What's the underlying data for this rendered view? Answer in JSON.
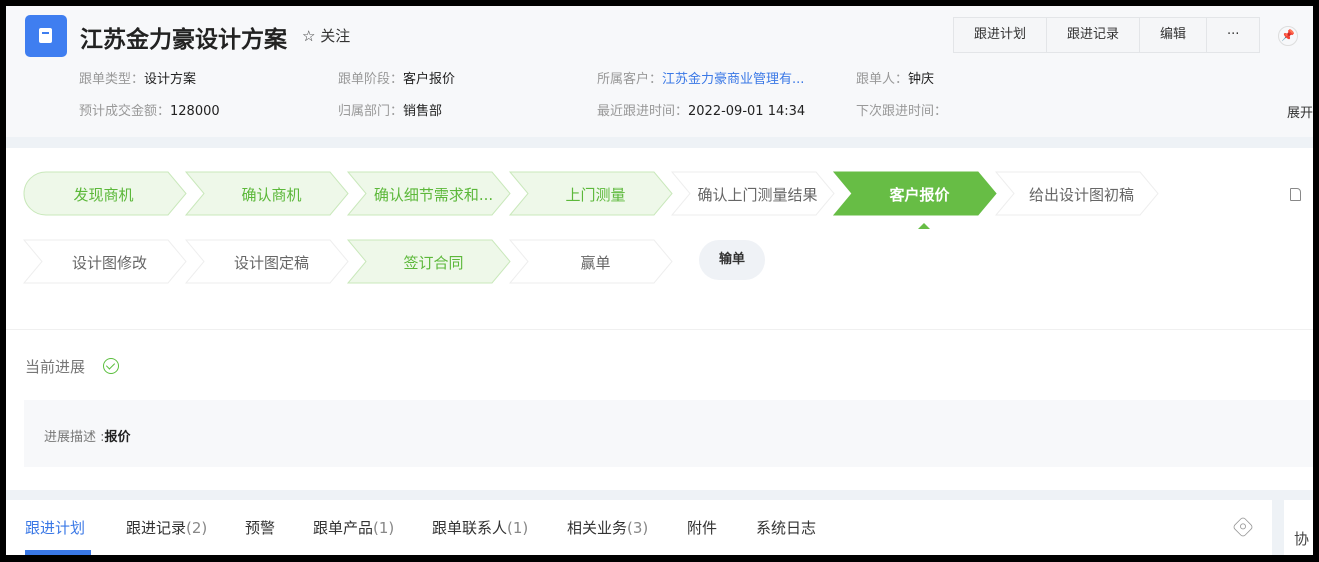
{
  "header": {
    "title": "江苏金力豪设计方案",
    "follow_label": "关注",
    "buttons": [
      "跟进计划",
      "跟进记录",
      "编辑",
      "···"
    ],
    "meta": [
      {
        "label": "跟单类型：",
        "value": "设计方案"
      },
      {
        "label": "跟单阶段：",
        "value": "客户报价"
      },
      {
        "label": "所属客户：",
        "value": "江苏金力豪商业管理有..."
      },
      {
        "label": "跟单人：",
        "value": "钟庆"
      },
      {
        "label": "预计成交金额：",
        "value": "128000"
      },
      {
        "label": "归属部门：",
        "value": "销售部"
      },
      {
        "label": "最近跟进时间：",
        "value": "2022-09-01 14:34"
      },
      {
        "label": "下次跟进时间：",
        "value": ""
      }
    ],
    "expand_label": "展开"
  },
  "stages": [
    {
      "label": "发现商机",
      "state": "done"
    },
    {
      "label": "确认商机",
      "state": "done"
    },
    {
      "label": "确认细节需求和...",
      "state": "done"
    },
    {
      "label": "上门测量",
      "state": "done"
    },
    {
      "label": "确认上门测量结果",
      "state": "pending"
    },
    {
      "label": "客户报价",
      "state": "current"
    },
    {
      "label": "给出设计图初稿",
      "state": "pending"
    },
    {
      "label": "设计图修改",
      "state": "pending"
    },
    {
      "label": "设计图定稿",
      "state": "pending"
    },
    {
      "label": "签订合同",
      "state": "done"
    },
    {
      "label": "赢单",
      "state": "pending"
    }
  ],
  "lose_label": "输单",
  "progress": {
    "title": "当前进展",
    "desc_label": "进展描述 :",
    "desc_value": "报价"
  },
  "tabs": [
    {
      "label": "跟进计划",
      "count": ""
    },
    {
      "label": "跟进记录",
      "count": "(2)"
    },
    {
      "label": "预警",
      "count": ""
    },
    {
      "label": "跟单产品",
      "count": "(1)"
    },
    {
      "label": "跟单联系人",
      "count": "(1)"
    },
    {
      "label": "相关业务",
      "count": "(3)"
    },
    {
      "label": "附件",
      "count": ""
    },
    {
      "label": "系统日志",
      "count": ""
    }
  ],
  "right_col_label": "协",
  "colors": {
    "accent": "#3a78e6",
    "stage_current": "#67bd45",
    "stage_done_fill": "#eef8e9",
    "stage_done_text": "#5cb83a"
  }
}
